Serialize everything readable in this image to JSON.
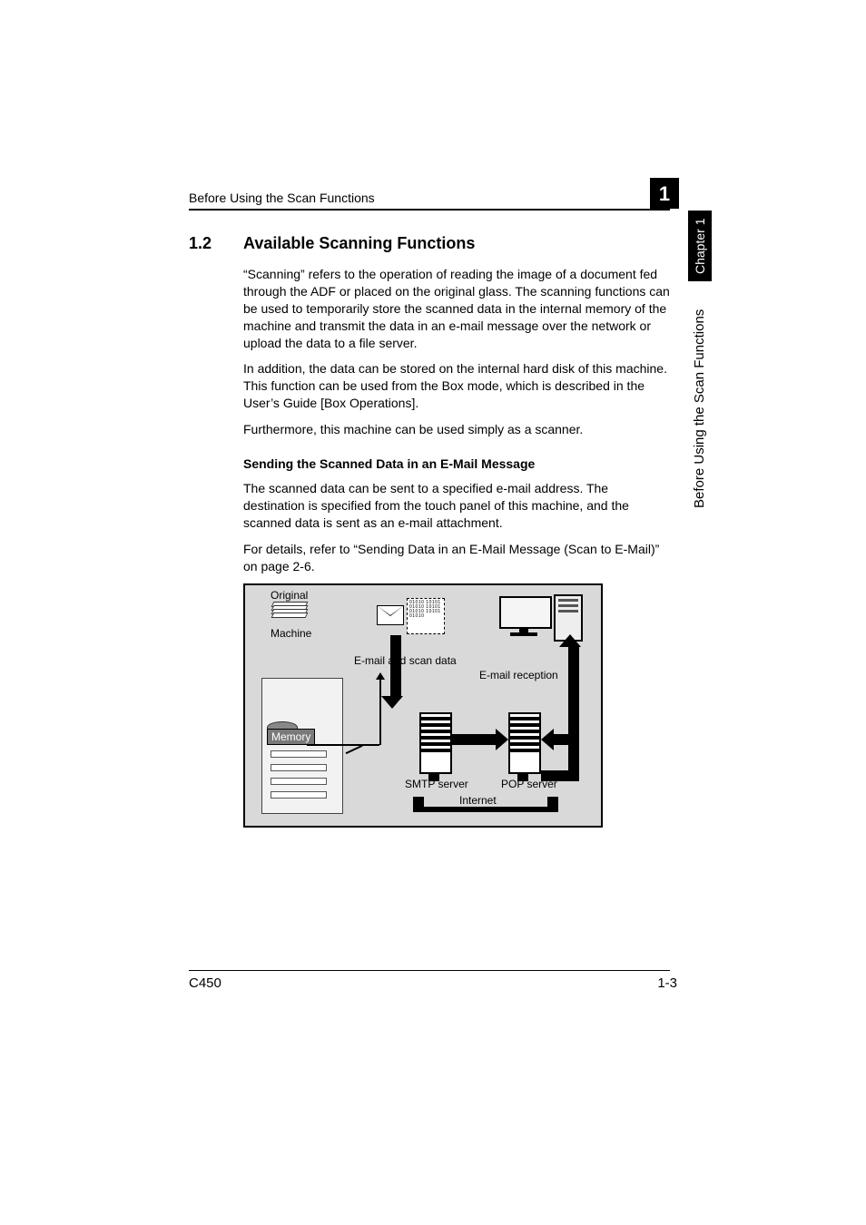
{
  "header": {
    "running_head": "Before Using the Scan Functions",
    "chapter_badge": "1",
    "chapter_tab": "Chapter 1",
    "side_text": "Before Using the Scan Functions"
  },
  "section": {
    "number": "1.2",
    "title": "Available Scanning Functions"
  },
  "paragraphs": {
    "p1": "“Scanning” refers to the operation of reading the image of a document fed through the ADF or placed on the original glass. The scanning functions can be used to temporarily store the scanned data in the internal memory of the machine and transmit the data in an e-mail message over the network or upload the data to a file server.",
    "p2": "In addition, the data can be stored on the internal hard disk of this machine. This function can be used from the Box mode, which is described in the User’s Guide [Box Operations].",
    "p3": "Furthermore, this machine can be used simply as a scanner."
  },
  "subheading": "Sending the Scanned Data in an E-Mail Message",
  "sub_paragraphs": {
    "s1": "The scanned data can be sent to a specified e-mail address. The destination is specified from the touch panel of this machine, and the scanned data is sent as an e-mail attachment.",
    "s2": "For details, refer to “Sending Data in an E-Mail Message (Scan to E-Mail)” on page 2-6."
  },
  "diagram": {
    "original": "Original",
    "machine": "Machine",
    "memory": "Memory",
    "email_scan_data": "E-mail and scan data",
    "email_reception": "E-mail reception",
    "smtp": "SMTP server",
    "pop": "POP server",
    "internet": "Internet"
  },
  "footer": {
    "model": "C450",
    "page": "1-3"
  }
}
